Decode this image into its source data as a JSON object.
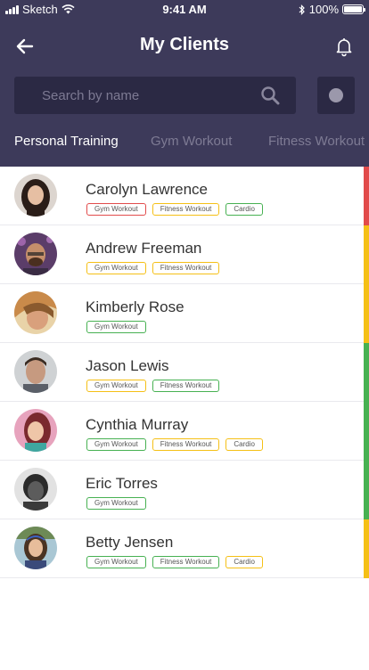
{
  "status_bar": {
    "carrier": "Sketch",
    "time": "9:41 AM",
    "battery": "100%"
  },
  "header": {
    "title": "My Clients"
  },
  "search": {
    "placeholder": "Search by name"
  },
  "tabs": [
    {
      "label": "Personal Training",
      "active": true
    },
    {
      "label": "Gym Workout",
      "active": false
    },
    {
      "label": "Fitness Workout",
      "active": false
    }
  ],
  "colors": {
    "header_bg": "#3d3a5a",
    "status_red": "#e24b4b",
    "status_yellow": "#f5c016",
    "status_green": "#47b152"
  },
  "clients": [
    {
      "name": "Carolyn Lawrence",
      "status": "red",
      "tags": [
        {
          "label": "Gym Workout",
          "color": "red"
        },
        {
          "label": "Fitness Workout",
          "color": "yellow"
        },
        {
          "label": "Cardio",
          "color": "green"
        }
      ]
    },
    {
      "name": "Andrew Freeman",
      "status": "yellow",
      "tags": [
        {
          "label": "Gym Workout",
          "color": "yellow"
        },
        {
          "label": "Fitness Workout",
          "color": "yellow"
        }
      ]
    },
    {
      "name": "Kimberly Rose",
      "status": "yellow",
      "tags": [
        {
          "label": "Gym Workout",
          "color": "green"
        }
      ]
    },
    {
      "name": "Jason Lewis",
      "status": "green",
      "tags": [
        {
          "label": "Gym Workout",
          "color": "yellow"
        },
        {
          "label": "Fitness Workout",
          "color": "green"
        }
      ]
    },
    {
      "name": "Cynthia Murray",
      "status": "green",
      "tags": [
        {
          "label": "Gym Workout",
          "color": "green"
        },
        {
          "label": "Fitness Workout",
          "color": "yellow"
        },
        {
          "label": "Cardio",
          "color": "yellow"
        }
      ]
    },
    {
      "name": "Eric Torres",
      "status": "green",
      "tags": [
        {
          "label": "Gym Workout",
          "color": "green"
        }
      ]
    },
    {
      "name": "Betty Jensen",
      "status": "yellow",
      "tags": [
        {
          "label": "Gym Workout",
          "color": "green"
        },
        {
          "label": "Fitness Workout",
          "color": "green"
        },
        {
          "label": "Cardio",
          "color": "yellow"
        }
      ]
    }
  ]
}
